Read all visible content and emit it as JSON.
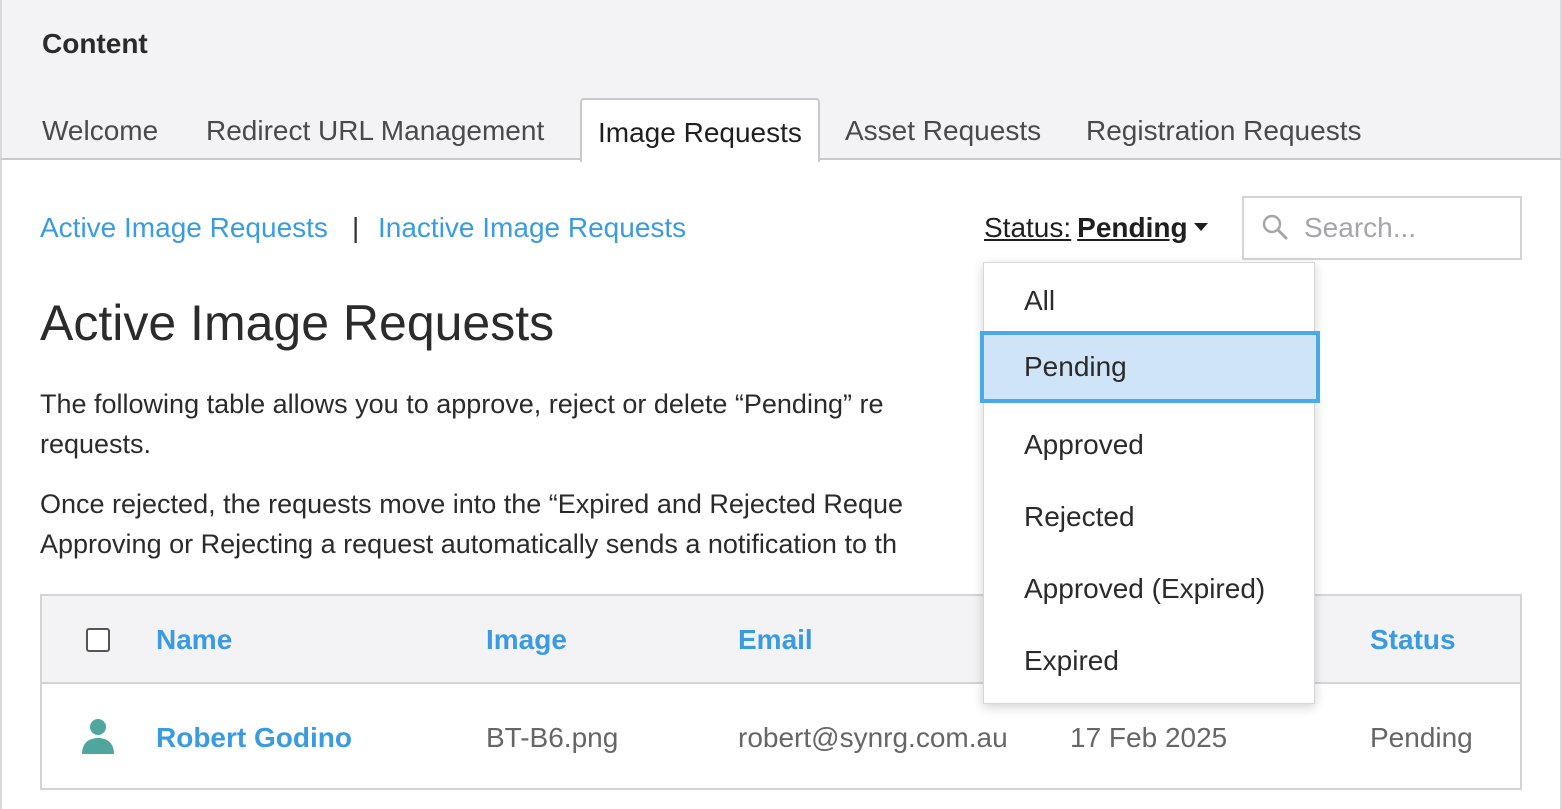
{
  "header": {
    "title": "Content"
  },
  "tabs": [
    {
      "label": "Welcome",
      "active": false
    },
    {
      "label": "Redirect URL Management",
      "active": false
    },
    {
      "label": "Image Requests",
      "active": true
    },
    {
      "label": "Asset Requests",
      "active": false
    },
    {
      "label": "Registration Requests",
      "active": false
    }
  ],
  "sublinks": {
    "active": "Active Image Requests",
    "separator": "|",
    "inactive": "Inactive Image Requests"
  },
  "filter": {
    "label": "Status:",
    "value": "Pending"
  },
  "search": {
    "placeholder": "Search...",
    "value": ""
  },
  "page": {
    "title": "Active Image Requests",
    "para1_line1": "The following table allows you to approve, reject or delete “Pending” re",
    "para1_line2": "requests.",
    "para2_line1": "Once rejected, the requests move into the “Expired and Rejected Reque",
    "para2_line2": "Approving or Rejecting a request automatically sends a notification to th"
  },
  "table": {
    "columns": {
      "name": "Name",
      "image": "Image",
      "email": "Email",
      "status": "Status"
    },
    "rows": [
      {
        "name": "Robert Godino",
        "image": "BT-B6.png",
        "email": "robert@synrg.com.au",
        "date": "17 Feb 2025",
        "status": "Pending"
      }
    ]
  },
  "dropdown": {
    "options": [
      "All",
      "Pending",
      "Approved",
      "Rejected",
      "Approved (Expired)",
      "Expired"
    ],
    "selected": "Pending"
  },
  "colors": {
    "link": "#3a9be0",
    "selected_bg": "#d0e4f7",
    "selected_border": "#4aa8ec",
    "avatar": "#4fa69e"
  },
  "icons": {
    "search": "search-icon",
    "avatar": "user-avatar-icon",
    "caret": "caret-down-icon"
  }
}
